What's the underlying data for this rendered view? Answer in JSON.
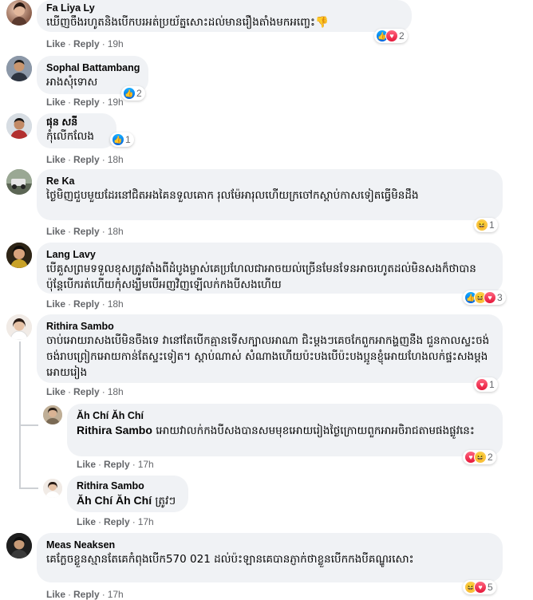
{
  "actions": {
    "like": "Like",
    "reply": "Reply"
  },
  "comments": [
    {
      "author": "Fa Liya Ly",
      "text": "ឃើញចឹងរហូតនិងបើកបរអត់ប្រយ័ត្នសោះដល់មានរឿងតាំងមកអញ្ចេះ👎",
      "time": "19h",
      "reactions": [
        "like",
        "love"
      ],
      "reaction_count": "2"
    },
    {
      "author": "Sophal Battambang",
      "text": "អាងសុំទោស",
      "time": "19h",
      "reactions": [
        "like"
      ],
      "reaction_count": "2"
    },
    {
      "author": "ផុន សនី",
      "text": "កុំលើកលែង",
      "time": "18h",
      "reactions": [
        "like"
      ],
      "reaction_count": "1"
    },
    {
      "author": "Re Ka",
      "text": "ថ្ងៃមិញជួបមួយដែរនៅជិតអងគៃនទួលគោក រុលម៉ែអារុលហើយក្រចៅកស្តាប់កាសទៀតធ្វើមិនដឹង",
      "time": "18h",
      "reactions": [
        "haha"
      ],
      "reaction_count": "1"
    },
    {
      "author": "Lang Lavy",
      "text": "បើគួសព្រមទទួលខុសត្រូវតាំងពីដំបូងម្ចាស់គេប្រហែលជាអាចយល់ច្រើនមែនទែនអាចរហូតដល់មិនសងក៏ថាបានប៉ុន្តែបើករត់ហើយកុំសង្ឃឹមបើអញវិញឡើលក់កងបីសងហើយ",
      "time": "18h",
      "reactions": [
        "like",
        "haha",
        "love"
      ],
      "reaction_count": "3"
    },
    {
      "author": "Rithira Sambo",
      "text": "ចាប់អោយរាសងបើមិនចឹងទេ វានៅតែបើកគ្មានទើសក្បាលអាណា ជិះម្តងៗគេចកែពួកអាកង្ហញនឹង ជួនកាលស្ទះចង់ចង់រាបព្រៀកអោយកាន់តែស្ទះទៀត។ ស្តាប់ណាស់ សំណាងហើយប៉ះបងបើប៉ះបងប្អូនខ្ញុំអោយហែងលក់ផ្ទះសងម្តងអោយរៀង",
      "time": "18h",
      "reactions": [
        "love"
      ],
      "reaction_count": "1"
    },
    {
      "author": "Ăh Chí Ăh Chí",
      "mention": "Rithira Sambo",
      "text": "អោយវាលក់កងបីសងបានសមមុខអោយរៀងថ្ងៃក្រោយពួកអាអចិរាជតាមផងផ្លូវនេះ",
      "time": "17h",
      "reactions": [
        "love",
        "haha"
      ],
      "reaction_count": "2"
    },
    {
      "author": "Rithira Sambo",
      "mention": "Ăh Chí Ăh Chí",
      "text": "ត្រូវៗ",
      "time": "17h",
      "reactions": [],
      "reaction_count": ""
    },
    {
      "author": "Meas Neaksen",
      "text": "គេក្លែចខ្លួនស្មានតែគេកំពុងបើក570 021 ដល់ប៉ះឡានគេបានភ្ញាក់ថាខ្លួនបើកកងបីគណ្ឌូរសោះ",
      "time": "17h",
      "reactions": [
        "haha",
        "love"
      ],
      "reaction_count": "5"
    }
  ]
}
